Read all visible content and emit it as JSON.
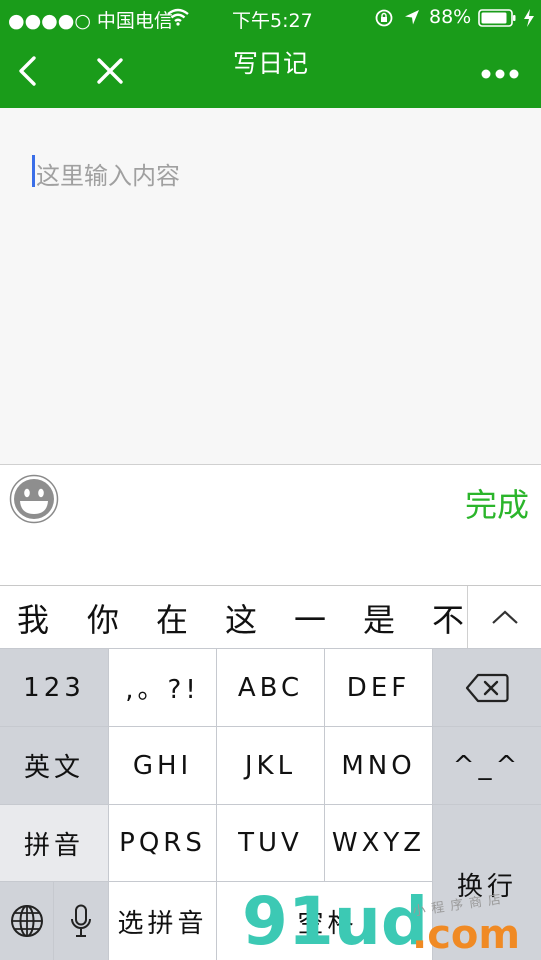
{
  "status_bar": {
    "carrier": "●●●●○ 中国电信",
    "time": "下午5:27",
    "battery": "88%"
  },
  "nav": {
    "title": "写日记"
  },
  "editor": {
    "placeholder": "这里输入内容"
  },
  "toolbar": {
    "done_label": "完成"
  },
  "candidates": [
    "我",
    "你",
    "在",
    "这",
    "一",
    "是",
    "不"
  ],
  "keyboard": {
    "row1": [
      "123",
      ",。?!",
      "ABC",
      "DEF"
    ],
    "row2": [
      "英文",
      "GHI",
      "JKL",
      "MNO",
      "^_^"
    ],
    "row3": [
      "拼音",
      "PQRS",
      "TUV",
      "WXYZ"
    ],
    "enter": "换行",
    "select_pinyin": "选拼音",
    "space": "空格"
  },
  "watermark": {
    "brand": "91ud",
    "tld": ".com",
    "tagline": "小程序商店"
  },
  "colors": {
    "nav_green": "#1a9c1a",
    "done_green": "#2bb52b",
    "caret_blue": "#3a6ee8"
  }
}
